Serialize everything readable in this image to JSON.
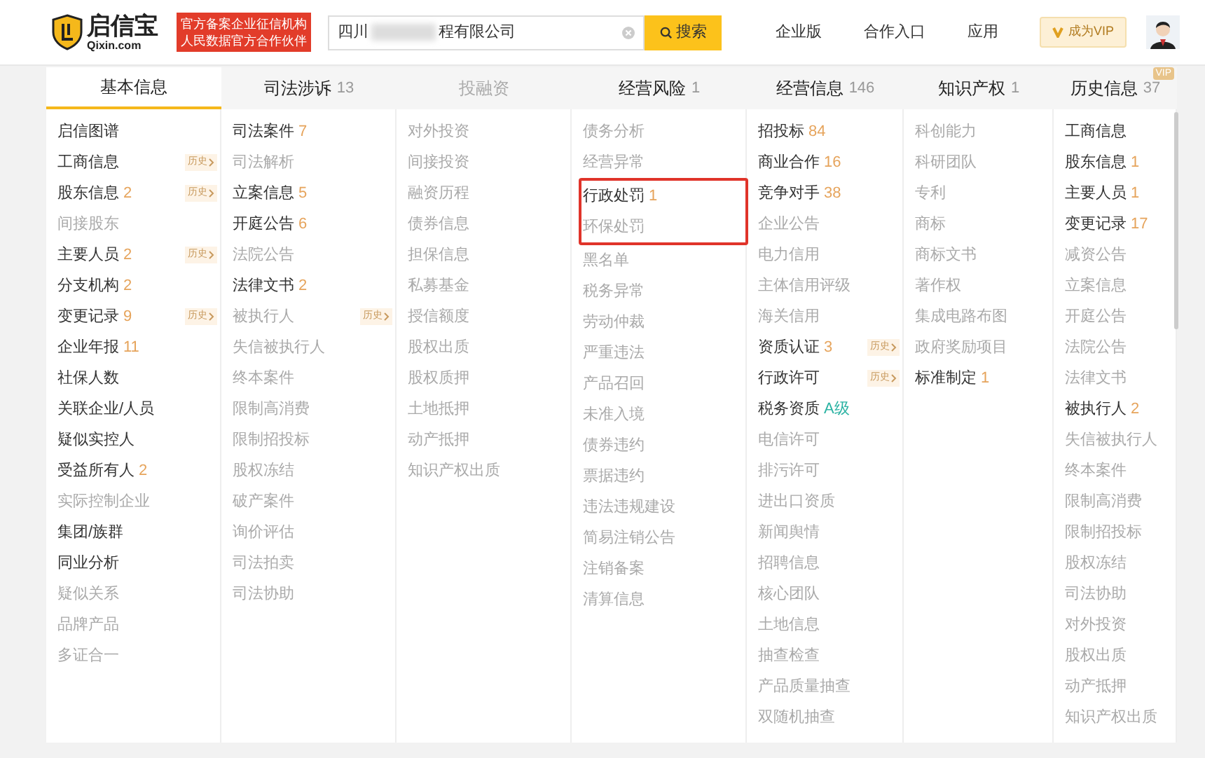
{
  "header": {
    "logo": {
      "name": "启信宝",
      "domain": "Qixin.com"
    },
    "notice": [
      "官方备案企业征信机构",
      "人民数据官方合作伙伴"
    ],
    "search": {
      "value_start": "四川",
      "value_end": "程有限公司",
      "button": "搜索"
    },
    "nav": [
      "企业版",
      "合作入口",
      "应用"
    ],
    "vip_button": "成为VIP"
  },
  "tabs": [
    {
      "label": "基本信息",
      "selected": true,
      "disabled": false
    },
    {
      "label": "司法涉诉",
      "count": "13",
      "selected": false,
      "disabled": false
    },
    {
      "label": "投融资",
      "selected": false,
      "disabled": true
    },
    {
      "label": "经营风险",
      "count": "1",
      "selected": false,
      "disabled": false
    },
    {
      "label": "经营信息",
      "count": "146",
      "selected": false,
      "disabled": false
    },
    {
      "label": "知识产权",
      "count": "1",
      "selected": false,
      "disabled": false
    },
    {
      "label": "历史信息",
      "count": "37",
      "badge": "VIP",
      "selected": false,
      "disabled": false
    }
  ],
  "columns": [
    [
      {
        "label": "启信图谱",
        "disabled": false
      },
      {
        "label": "工商信息",
        "badge": "历史",
        "disabled": false
      },
      {
        "label": "股东信息",
        "count": "2",
        "badge": "历史",
        "disabled": false
      },
      {
        "label": "间接股东",
        "disabled": true
      },
      {
        "label": "主要人员",
        "count": "2",
        "badge": "历史",
        "disabled": false
      },
      {
        "label": "分支机构",
        "count": "2",
        "disabled": false
      },
      {
        "label": "变更记录",
        "count": "9",
        "badge": "历史",
        "disabled": false
      },
      {
        "label": "企业年报",
        "count": "11",
        "disabled": false
      },
      {
        "label": "社保人数",
        "disabled": false
      },
      {
        "label": "关联企业/人员",
        "disabled": false
      },
      {
        "label": "疑似实控人",
        "disabled": false
      },
      {
        "label": "受益所有人",
        "count": "2",
        "disabled": false
      },
      {
        "label": "实际控制企业",
        "disabled": true
      },
      {
        "label": "集团/族群",
        "disabled": false
      },
      {
        "label": "同业分析",
        "disabled": false
      },
      {
        "label": "疑似关系",
        "disabled": true
      },
      {
        "label": "品牌产品",
        "disabled": true
      },
      {
        "label": "多证合一",
        "disabled": true
      }
    ],
    [
      {
        "label": "司法案件",
        "count": "7",
        "disabled": false
      },
      {
        "label": "司法解析",
        "disabled": true
      },
      {
        "label": "立案信息",
        "count": "5",
        "disabled": false
      },
      {
        "label": "开庭公告",
        "count": "6",
        "disabled": false
      },
      {
        "label": "法院公告",
        "disabled": true
      },
      {
        "label": "法律文书",
        "count": "2",
        "disabled": false
      },
      {
        "label": "被执行人",
        "badge": "历史",
        "disabled": true
      },
      {
        "label": "失信被执行人",
        "disabled": true
      },
      {
        "label": "终本案件",
        "disabled": true
      },
      {
        "label": "限制高消费",
        "disabled": true
      },
      {
        "label": "限制招投标",
        "disabled": true
      },
      {
        "label": "股权冻结",
        "disabled": true
      },
      {
        "label": "破产案件",
        "disabled": true
      },
      {
        "label": "询价评估",
        "disabled": true
      },
      {
        "label": "司法拍卖",
        "disabled": true
      },
      {
        "label": "司法协助",
        "disabled": true
      }
    ],
    [
      {
        "label": "对外投资",
        "disabled": true
      },
      {
        "label": "间接投资",
        "disabled": true
      },
      {
        "label": "融资历程",
        "disabled": true
      },
      {
        "label": "债券信息",
        "disabled": true
      },
      {
        "label": "担保信息",
        "disabled": true
      },
      {
        "label": "私募基金",
        "disabled": true
      },
      {
        "label": "授信额度",
        "disabled": true
      },
      {
        "label": "股权出质",
        "disabled": true
      },
      {
        "label": "股权质押",
        "disabled": true
      },
      {
        "label": "土地抵押",
        "disabled": true
      },
      {
        "label": "动产抵押",
        "disabled": true
      },
      {
        "label": "知识产权出质",
        "disabled": true
      }
    ],
    [
      {
        "label": "债务分析",
        "disabled": true
      },
      {
        "label": "经营异常",
        "disabled": true
      },
      {
        "label": "行政处罚",
        "count": "1",
        "disabled": false,
        "outlined": true
      },
      {
        "label": "环保处罚",
        "disabled": true,
        "outlined": true
      },
      {
        "label": "黑名单",
        "disabled": true
      },
      {
        "label": "税务异常",
        "disabled": true
      },
      {
        "label": "劳动仲裁",
        "disabled": true
      },
      {
        "label": "严重违法",
        "disabled": true
      },
      {
        "label": "产品召回",
        "disabled": true
      },
      {
        "label": "未准入境",
        "disabled": true
      },
      {
        "label": "债券违约",
        "disabled": true
      },
      {
        "label": "票据违约",
        "disabled": true
      },
      {
        "label": "违法违规建设",
        "disabled": true
      },
      {
        "label": "简易注销公告",
        "disabled": true
      },
      {
        "label": "注销备案",
        "disabled": true
      },
      {
        "label": "清算信息",
        "disabled": true
      }
    ],
    [
      {
        "label": "招投标",
        "count": "84",
        "disabled": false
      },
      {
        "label": "商业合作",
        "count": "16",
        "disabled": false
      },
      {
        "label": "竞争对手",
        "count": "38",
        "disabled": false
      },
      {
        "label": "企业公告",
        "disabled": true
      },
      {
        "label": "电力信用",
        "disabled": true
      },
      {
        "label": "主体信用评级",
        "disabled": true
      },
      {
        "label": "海关信用",
        "disabled": true
      },
      {
        "label": "资质认证",
        "count": "3",
        "badge": "历史",
        "disabled": false
      },
      {
        "label": "行政许可",
        "badge": "历史",
        "disabled": false
      },
      {
        "label": "税务资质",
        "grade": "A级",
        "disabled": false
      },
      {
        "label": "电信许可",
        "disabled": true
      },
      {
        "label": "排污许可",
        "disabled": true
      },
      {
        "label": "进出口资质",
        "disabled": true
      },
      {
        "label": "新闻舆情",
        "disabled": true
      },
      {
        "label": "招聘信息",
        "disabled": true
      },
      {
        "label": "核心团队",
        "disabled": true
      },
      {
        "label": "土地信息",
        "disabled": true
      },
      {
        "label": "抽查检查",
        "disabled": true
      },
      {
        "label": "产品质量抽查",
        "disabled": true
      },
      {
        "label": "双随机抽查",
        "disabled": true
      }
    ],
    [
      {
        "label": "科创能力",
        "disabled": true
      },
      {
        "label": "科研团队",
        "disabled": true
      },
      {
        "label": "专利",
        "disabled": true
      },
      {
        "label": "商标",
        "disabled": true
      },
      {
        "label": "商标文书",
        "disabled": true
      },
      {
        "label": "著作权",
        "disabled": true
      },
      {
        "label": "集成电路布图",
        "disabled": true
      },
      {
        "label": "政府奖励项目",
        "disabled": true
      },
      {
        "label": "标准制定",
        "count": "1",
        "disabled": false
      }
    ],
    [
      {
        "label": "工商信息",
        "disabled": false
      },
      {
        "label": "股东信息",
        "count": "1",
        "disabled": false
      },
      {
        "label": "主要人员",
        "count": "1",
        "disabled": false
      },
      {
        "label": "变更记录",
        "count": "17",
        "disabled": false
      },
      {
        "label": "减资公告",
        "disabled": true
      },
      {
        "label": "立案信息",
        "disabled": true
      },
      {
        "label": "开庭公告",
        "disabled": true
      },
      {
        "label": "法院公告",
        "disabled": true
      },
      {
        "label": "法律文书",
        "disabled": true
      },
      {
        "label": "被执行人",
        "count": "2",
        "disabled": false
      },
      {
        "label": "失信被执行人",
        "disabled": true
      },
      {
        "label": "终本案件",
        "disabled": true
      },
      {
        "label": "限制高消费",
        "disabled": true
      },
      {
        "label": "限制招投标",
        "disabled": true
      },
      {
        "label": "股权冻结",
        "disabled": true
      },
      {
        "label": "司法协助",
        "disabled": true
      },
      {
        "label": "对外投资",
        "disabled": true
      },
      {
        "label": "股权出质",
        "disabled": true
      },
      {
        "label": "动产抵押",
        "disabled": true
      },
      {
        "label": "知识产权出质",
        "disabled": true
      }
    ]
  ]
}
